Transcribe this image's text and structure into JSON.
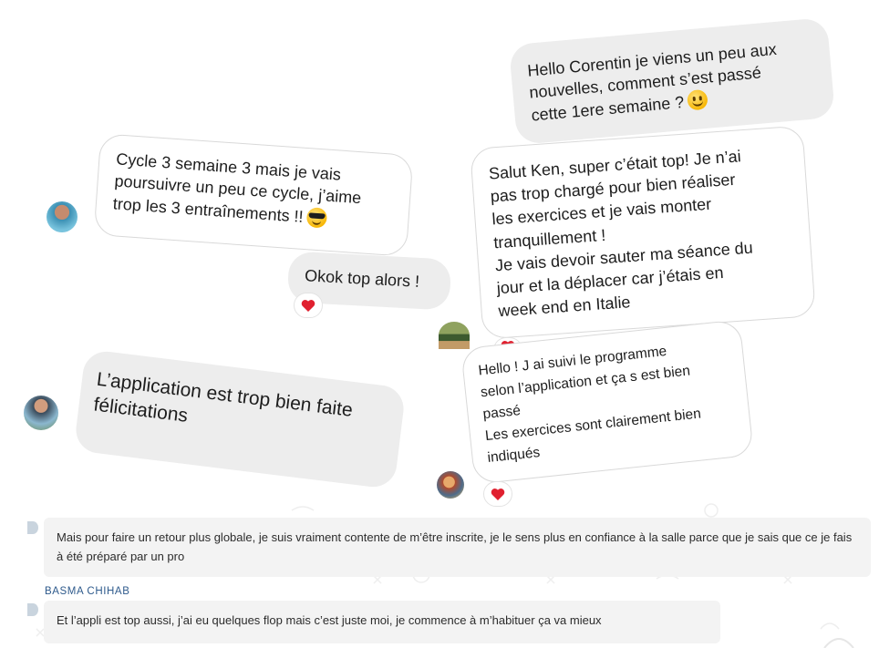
{
  "bubbles": {
    "hello_corentin": {
      "lines": [
        "Hello Corentin je viens un peu aux",
        "nouvelles, comment s’est passé",
        "cette 1ere semaine ?"
      ],
      "emoji": "slightly-smiling-face"
    },
    "cycle3": {
      "lines": [
        "Cycle 3 semaine 3 mais je vais",
        "poursuivre un peu ce cycle, j’aime",
        "trop les 3 entraînements !!"
      ],
      "emoji": "smiling-face-with-sunglasses"
    },
    "salut_ken": {
      "lines": [
        "Salut Ken, super c’était top! Je n’ai",
        "pas trop chargé pour bien réaliser",
        "les exercices et je vais monter",
        "tranquillement !",
        "Je vais devoir sauter ma séance du",
        "jour et la déplacer car j’étais en",
        "week end en Italie"
      ]
    },
    "okok": {
      "lines": [
        "Okok top alors !"
      ],
      "reaction": "red-heart"
    },
    "application": {
      "lines": [
        "L’application est trop bien faite",
        "félicitations"
      ]
    },
    "hello_j_ai": {
      "lines": [
        "Hello ! J ai suivi le programme",
        "selon l’application et ça s est bien",
        "passé",
        "Les exercices sont clairement bien",
        "indiqués"
      ],
      "reaction": "red-heart"
    }
  },
  "chat": {
    "message1": "Mais pour faire un retour plus globale, je suis vraiment contente de m’être inscrite, je le sens plus en confiance à la salle parce que je sais que ce je fais à été préparé par un pro",
    "sender": "BASMA CHIHAB",
    "message2": "Et l’appli est top aussi, j’ai eu quelques flop mais c’est juste moi, je commence à m’habituer ça va mieux"
  },
  "colors": {
    "heart": "#e0202f",
    "sender": "#2e5a8c",
    "bubble_grey": "#ededed"
  }
}
